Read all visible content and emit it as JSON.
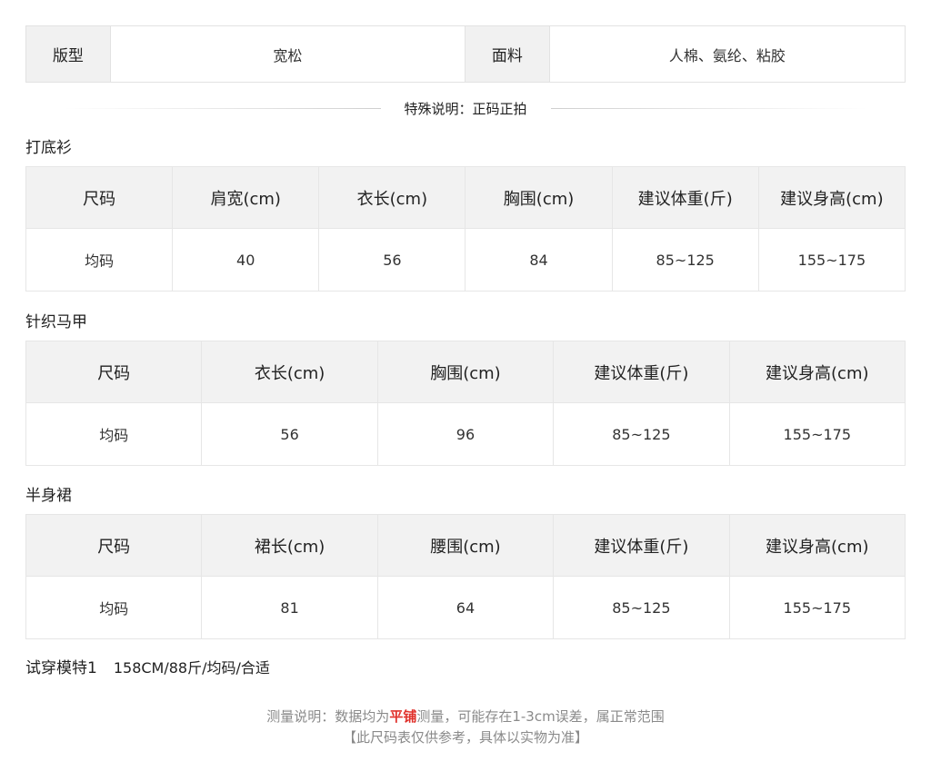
{
  "props": {
    "fit_label": "版型",
    "fit_value": "宽松",
    "fabric_label": "面料",
    "fabric_value": "人棉、氨纶、粘胶"
  },
  "special_note": "特殊说明：正码正拍",
  "tables": [
    {
      "title": "打底衫",
      "headers": [
        "尺码",
        "肩宽(cm)",
        "衣长(cm)",
        "胸围(cm)",
        "建议体重(斤)",
        "建议身高(cm)"
      ],
      "row": [
        "均码",
        "40",
        "56",
        "84",
        "85~125",
        "155~175"
      ]
    },
    {
      "title": "针织马甲",
      "headers": [
        "尺码",
        "衣长(cm)",
        "胸围(cm)",
        "建议体重(斤)",
        "建议身高(cm)"
      ],
      "row": [
        "均码",
        "56",
        "96",
        "85~125",
        "155~175"
      ]
    },
    {
      "title": "半身裙",
      "headers": [
        "尺码",
        "裙长(cm)",
        "腰围(cm)",
        "建议体重(斤)",
        "建议身高(cm)"
      ],
      "row": [
        "均码",
        "81",
        "64",
        "85~125",
        "155~175"
      ]
    }
  ],
  "model": {
    "label": "试穿模特1",
    "value": "158CM/88斤/均码/合适"
  },
  "footer": {
    "line1_prefix": "测量说明：数据均为",
    "line1_emphasis": "平铺",
    "line1_suffix": "测量，可能存在1-3cm误差，属正常范围",
    "line2": "【此尺码表仅供参考，具体以实物为准】"
  }
}
